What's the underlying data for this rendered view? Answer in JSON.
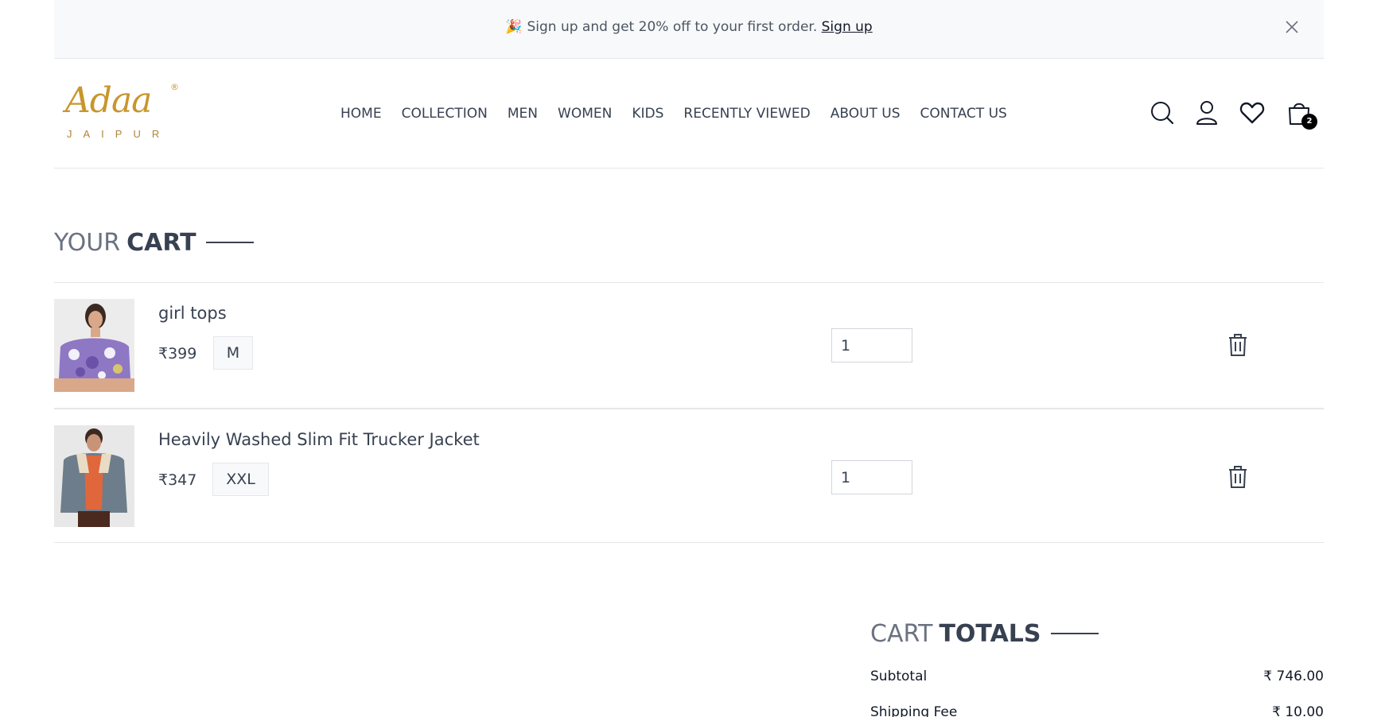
{
  "announcement": {
    "emoji": "🎉",
    "text": "Sign up and get 20% off to your first order.",
    "link_label": "Sign up",
    "close_icon": "close-icon"
  },
  "brand": {
    "logo_script": "Adaa",
    "logo_sub": "JAIPUR",
    "logo_reg": "®"
  },
  "nav": {
    "items": [
      "HOME",
      "COLLECTION",
      "MEN",
      "WOMEN",
      "KIDS",
      "RECENTLY VIEWED",
      "ABOUT US",
      "CONTACT US"
    ]
  },
  "header_icons": {
    "search": "search-icon",
    "profile": "user-icon",
    "wishlist": "heart-icon",
    "cart": "shopping-bag-icon",
    "cart_count": "2"
  },
  "cart": {
    "title_light": "YOUR",
    "title_bold": "CART",
    "items": [
      {
        "name": "girl tops",
        "price": "₹399",
        "size": "M",
        "quantity": "1",
        "remove_icon": "trash-icon"
      },
      {
        "name": "Heavily Washed Slim Fit Trucker Jacket",
        "price": "₹347",
        "size": "XXL",
        "quantity": "1",
        "remove_icon": "trash-icon"
      }
    ]
  },
  "totals": {
    "title_light": "CART",
    "title_bold": "TOTALS",
    "subtotal_label": "Subtotal",
    "subtotal_value": "₹ 746.00",
    "shipping_label": "Shipping Fee",
    "shipping_value": "₹ 10.00"
  },
  "colors": {
    "brand_gold": "#c8962c",
    "text": "#374151",
    "announce_bg": "#f8f9fa",
    "border": "#e5e7eb"
  }
}
